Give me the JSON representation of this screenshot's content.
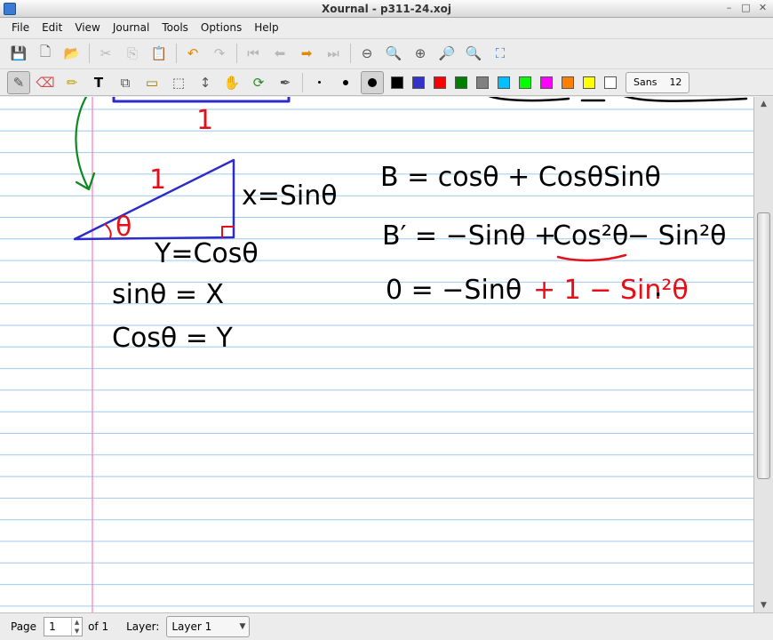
{
  "window": {
    "title": "Xournal - p311-24.xoj"
  },
  "menu": [
    "File",
    "Edit",
    "View",
    "Journal",
    "Tools",
    "Options",
    "Help"
  ],
  "toolbar_main": [
    {
      "icon": "save-icon",
      "glyph": "💾"
    },
    {
      "icon": "new-page-icon",
      "glyph": "🗋"
    },
    {
      "icon": "open-icon",
      "glyph": "📂"
    },
    {
      "icon": "cut-icon",
      "glyph": "✂"
    },
    {
      "icon": "copy-icon",
      "glyph": "⎘"
    },
    {
      "icon": "paste-icon",
      "glyph": "📋"
    },
    {
      "icon": "undo-icon",
      "glyph": "↶"
    },
    {
      "icon": "redo-icon",
      "glyph": "↷"
    },
    {
      "icon": "first-page-icon",
      "glyph": "⏮"
    },
    {
      "icon": "prev-page-icon",
      "glyph": "⬅"
    },
    {
      "icon": "next-page-icon",
      "glyph": "➡"
    },
    {
      "icon": "last-page-icon",
      "glyph": "⏭"
    },
    {
      "icon": "zoom-out-icon",
      "glyph": "⊖"
    },
    {
      "icon": "zoom-100-icon",
      "glyph": "🔍"
    },
    {
      "icon": "zoom-in-icon",
      "glyph": "⊕"
    },
    {
      "icon": "zoom-width-icon",
      "glyph": "🔎"
    },
    {
      "icon": "zoom-set-icon",
      "glyph": "🔍"
    },
    {
      "icon": "fullscreen-icon",
      "glyph": "⛶"
    }
  ],
  "toolbar_tools": [
    {
      "icon": "pen-icon",
      "glyph": "✎",
      "active": true
    },
    {
      "icon": "eraser-icon",
      "glyph": "⌫"
    },
    {
      "icon": "highlighter-icon",
      "glyph": "✏"
    },
    {
      "icon": "text-icon",
      "glyph": "T"
    },
    {
      "icon": "shape-recognizer-icon",
      "glyph": "⧉"
    },
    {
      "icon": "ruler-icon",
      "glyph": "▭"
    },
    {
      "icon": "select-rect-icon",
      "glyph": "⬚"
    },
    {
      "icon": "vertical-space-icon",
      "glyph": "↕"
    },
    {
      "icon": "hand-icon",
      "glyph": "✋"
    },
    {
      "icon": "default-pen-icon",
      "glyph": "⟳"
    },
    {
      "icon": "pen-settings-icon",
      "glyph": "✒"
    }
  ],
  "pen_colors": [
    "#000000",
    "#3333cc",
    "#ff0000",
    "#008000",
    "#808080",
    "#00c0ff",
    "#00ff00",
    "#ff00ff",
    "#ff8000",
    "#ffff00",
    "#ffffff"
  ],
  "font": {
    "name": "Sans",
    "size": "12"
  },
  "status": {
    "page_label": "Page",
    "page_value": "1",
    "of_label": "of 1",
    "layer_label": "Layer:",
    "layer_value": "Layer 1"
  },
  "notes": {
    "top_label": "1",
    "hyp_label": "1",
    "theta": "θ",
    "x_label": "x=Sinθ",
    "y_label": "Y=Cosθ",
    "sin_eq": "sinθ = X",
    "cos_eq": "Cosθ = Y",
    "eq1": "B = cosθ + CosθSinθ",
    "eq2_black": "B′ = −Sinθ +",
    "eq2_red_part": "Cos²θ",
    "eq2_tail": "− Sin²θ",
    "eq3_black": "0 = −Sinθ",
    "eq3_red": "+ 1 − Sin²θ",
    "eq3_dot": "."
  },
  "colors": {
    "ink_black": "#000000",
    "ink_blue": "#2c2cc8",
    "ink_red": "#e3101a",
    "ink_green": "#0a8a1e",
    "ruling": "#9ec9ec",
    "margin": "#ff7fbf"
  }
}
